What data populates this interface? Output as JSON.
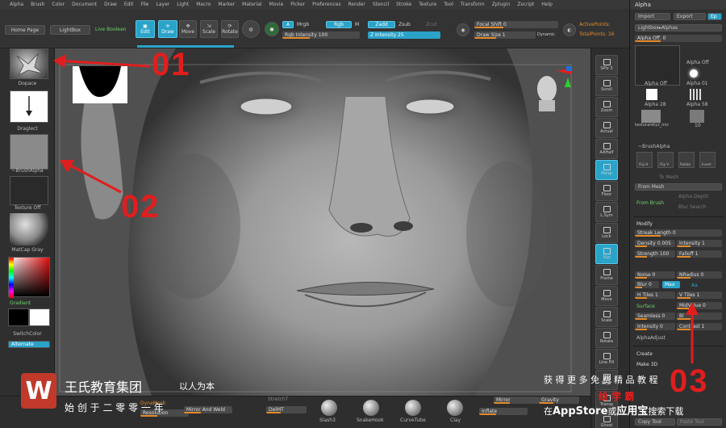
{
  "menu": [
    "Alpha",
    "Brush",
    "Color",
    "Document",
    "Draw",
    "Edit",
    "File",
    "Layer",
    "Light",
    "Macro",
    "Marker",
    "Material",
    "Movie",
    "Picker",
    "Preferences",
    "Render",
    "Stencil",
    "Stroke",
    "Texture",
    "Tool",
    "Transform",
    "Zplugin",
    "Zscript",
    "Help"
  ],
  "shelf": {
    "home_page": "Home Page",
    "lightbox": "LightBox",
    "live_boolean": "Live Boolean",
    "edit": "Edit",
    "draw": "Draw",
    "move": "Move",
    "scale": "Scale",
    "rotate": "Rotate",
    "a_btn": "A",
    "mrgb": "Mrgb",
    "rgb": "Rgb",
    "m": "M",
    "zadd": "Zadd",
    "zsub": "Zsub",
    "zcut": "Zcut",
    "rgb_intensity": "Rgb Intensity 100",
    "z_intensity": "Z Intensity 25",
    "focal_shift": "Focal Shift 0",
    "draw_size": "Draw Size 1",
    "dynamic": "Dynamic",
    "active_points": "ActivePoints:",
    "total_points": "TotalPoints: 16"
  },
  "left": {
    "brush_label": "Draglect",
    "alpha_label": "~BrushAlpha",
    "texture_label": "Texture Off",
    "matcap_label": "MatCap Gray",
    "gradient": "Gradient",
    "switch_color": "SwitchColor",
    "alternate": "Alternate",
    "top_label": "Dopace"
  },
  "rstrip": [
    "SPix 3",
    "Scroll",
    "Zoom",
    "Actual",
    "AAHalf",
    "Persp",
    "Floor",
    "L.Sym",
    "Lock",
    "Xyz",
    "Frame",
    "Move",
    "Scale",
    "Rotate",
    "Line Fill",
    "PolyF",
    "Transp",
    "Ghost"
  ],
  "panel": {
    "title": "Alpha",
    "import": "Import",
    "export": "Export",
    "ep": "Ep",
    "lightbox_alphas": "Lightbox▸Alphas",
    "alpha_off_slider": "Alpha Off. 0",
    "alpha_off_label": "Alpha Off",
    "alpha_off_label2": "Alpha Off",
    "alpha_01": "Alpha 01",
    "alpha_28": "Alpha 28",
    "alpha_58": "Alpha 58",
    "texture_name": "texturaretyz_mic",
    "ten": "10",
    "brushalpha": "~BrushAlpha",
    "flip_h": "Flip H",
    "flip_v": "Flip V",
    "rotate": "Rotate",
    "invert": "Invert",
    "to_mesh": "To Mesh",
    "from_mesh": "From Mesh",
    "from_brush": "From Brush",
    "alpha_depth": "Alpha Depth",
    "blur_search": "Blur Search",
    "modify": "Modify",
    "streak_length": "Streak Length 0",
    "density": "Density 0.005",
    "intensity": "Intensity 1",
    "strength": "Strength 100",
    "falloff": "Falloff 1",
    "noise": "Noise 0",
    "nradius": "NRadius 0",
    "blur": "Blur 0",
    "max": "Max",
    "aa": "Aa",
    "htiles": "H Tiles 1",
    "vtiles": "V Tiles 1",
    "surface": "Surface",
    "midvalue": "MidValue 0",
    "seamless": "Seamless 0",
    "bl": "Bl",
    "intensity0": "Intensity 0",
    "contrast": "Contrast 1",
    "alpha_adjust": "AlphaAdjust",
    "create": "Create",
    "make3d": "Make 3D",
    "copy_tool": "Copy Tool",
    "paste_tool": "Paste Tool"
  },
  "bottom": {
    "dynamesh": "DynaMesh",
    "resolution": "Resolution",
    "mirror_and_weld": "Mirror And Weld",
    "del_mt": "DelMT",
    "stretch": "StretchT",
    "brushes": [
      "Slash3",
      "SnakeHook",
      "CurveTube",
      "Clay"
    ],
    "mirror": "Mirror",
    "inflate": "Inflate",
    "gravity": "Gravity"
  },
  "annotations": [
    "01",
    "02",
    "03"
  ],
  "watermark": {
    "logo": "W",
    "brand": "王氏教育集团",
    "motto": "以人为本",
    "line2": "始  创  于  二  零  零  一  年",
    "promo1": "获 得 更 多 免 费 精 品 教 程",
    "promo2": "绘 学 霸",
    "promo3a": "在",
    "promo3b": "AppStore",
    "promo3c": "或",
    "promo3d": "应用宝",
    "promo3e": "搜索下载"
  },
  "colors": {
    "accent": "#2aa3c9",
    "annotation": "#e01e1e",
    "slider": "#e28a2b"
  }
}
